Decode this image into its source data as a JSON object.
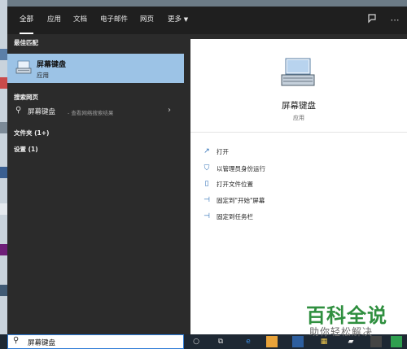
{
  "tabs": [
    {
      "label": "全部"
    },
    {
      "label": "应用"
    },
    {
      "label": "文档"
    },
    {
      "label": "电子邮件"
    },
    {
      "label": "网页"
    },
    {
      "label": "更多"
    }
  ],
  "sections": {
    "best_match": "最佳匹配",
    "web_search": "搜索网页",
    "folders": "文件夹 (1+)",
    "settings": "设置 (1)"
  },
  "best_result": {
    "title": "屏幕键盘",
    "subtitle": "应用"
  },
  "web_result": {
    "query": "屏幕键盘",
    "hint": " - 查看网络搜索结果"
  },
  "detail": {
    "title": "屏幕键盘",
    "subtitle": "应用"
  },
  "actions": [
    {
      "label": "打开",
      "icon": "open-icon"
    },
    {
      "label": "以管理员身份运行",
      "icon": "admin-shield-icon"
    },
    {
      "label": "打开文件位置",
      "icon": "file-location-icon"
    },
    {
      "label": "固定到\"开始\"屏幕",
      "icon": "pin-icon"
    },
    {
      "label": "固定到任务栏",
      "icon": "pin-icon"
    }
  ],
  "search": {
    "value": "屏幕键盘"
  },
  "watermark": {
    "line1": "百科全说",
    "line2": "助你轻松解决"
  },
  "colors": {
    "accent": "#2d7bd6",
    "highlight": "#9cc3e6",
    "watermark": "#2f8f3f"
  }
}
